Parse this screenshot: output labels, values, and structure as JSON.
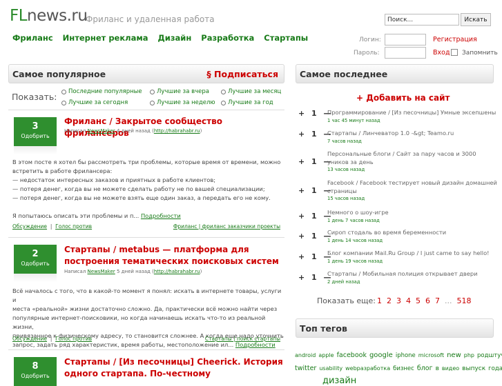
{
  "header": {
    "logo_prefix": "FL",
    "logo_suffix": "news.ru",
    "tagline": "Фриланс и удаленная работа",
    "search_placeholder": "Поиск...",
    "search_button": "Искать"
  },
  "nav": [
    "Фриланс",
    "Интернет реклама",
    "Дизайн",
    "Разработка",
    "Стартапы"
  ],
  "auth": {
    "login_label": "Логин:",
    "password_label": "Пароль:",
    "register": "Регистрация",
    "login_link": "Вход",
    "remember": "Запомнить"
  },
  "popular": {
    "title": "Самое популярное",
    "subscribe": "§ Подписаться",
    "show_label": "Показать:",
    "filters": [
      "Последние популярные",
      "Лучшие за вчера",
      "Лучшие за месяц",
      "Лучшие за сегодня",
      "Лучшие за неделю",
      "Лучшие за год"
    ]
  },
  "posts": [
    {
      "votes": "3",
      "vote_label": "Одобрить",
      "title": "Фриланс / Закрытое сообщество фрилансеров",
      "meta_prefix": "Написал",
      "author": "NewsMaker",
      "meta_time": "4 дней назад (",
      "source": "http://habrahabr.ru",
      "meta_end": ")",
      "body": [
        "В этом посте я хотел бы рассмотреть три проблемы, которые время от времени, можно",
        "встретить в работе фрилансера:",
        "— недостаток интересных заказов и приятных в работе клиентов;",
        "— потеря денег, когда вы не можете сделать работу не по вашей специализации;",
        "— потеря денег, когда вы не можете взять еще один заказ, а передать его не кому.",
        "",
        "Я попытаюсь описать эти проблемы и п..."
      ],
      "more": "Подробности",
      "discuss": "Обсуждение",
      "against": "Голос против",
      "tags": "Фриланс | фриланс заказчики проекты"
    },
    {
      "votes": "2",
      "vote_label": "Одобрить",
      "title": "Стартапы / metabus — платформа для построения тематических поисковых систем",
      "meta_prefix": "Написал",
      "author": "NewsMaker",
      "meta_time": "5 дней назад (",
      "source": "http://habrahabr.ru",
      "meta_end": ")",
      "body": [
        "Всё началось с того, что в какой-то момент я понял: искать в интернете товары, услуги и",
        "места «реальной» жизни достаточно сложно. Да, практически всё можно найти через",
        "популярные интернет-поисковики, но когда начинаешь искать что-то из реальной жизни,",
        "привязанное к физическому адресу, то становится сложнее. А когда еще надо уточнить",
        "запрос, задать ряд характеристик, время работы, местоположение ил..."
      ],
      "more": "Подробности",
      "discuss": "Обсуждение",
      "against": "Голос против",
      "tags": "Стартапы | поиск стартапы"
    },
    {
      "votes": "8",
      "vote_label": "Одобрить",
      "title": "Стартапы / [Из песочницы] Cheerick. История одного стартапа. По-честному"
    }
  ],
  "latest": {
    "title": "Самое последнее",
    "add": "+ Добавить на сайт",
    "items": [
      {
        "pm": "+ 1 —",
        "title": "Программирование / [Из песочницы] Умные эксепшены",
        "time": "1 час 45 минут назад"
      },
      {
        "pm": "+ 1 —",
        "title": "Стартапы / Линчеватор 1.0 -&gt; Teamo.ru",
        "time": "7 часов назад"
      },
      {
        "pm": "+ 1 —",
        "title": "Персональные блоги / Сайт за пару часов и 3000 уников за день",
        "time": "13 часов назад"
      },
      {
        "pm": "+ 1 —",
        "title": "Facebook / Facebook тестирует новый дизайн домашней страницы",
        "time": "15 часов назад"
      },
      {
        "pm": "+ 1 —",
        "title": "Немного о шоу-игре",
        "time": "1 день 7 часов назад"
      },
      {
        "pm": "+ 1 —",
        "title": "Сироп стодаль во время беременности",
        "time": "1 день 14 часов назад"
      },
      {
        "pm": "+ 1 —",
        "title": "Блог компании Mail.Ru Group / I just came to say hello!",
        "time": "1 день 19 часов назад"
      },
      {
        "pm": "+ 1 —",
        "title": "Стартапы / Мобильная полиция открывает двери",
        "time": "2 дней назад"
      }
    ],
    "more_label": "Показать еще:",
    "pages": [
      "1",
      "2",
      "3",
      "4",
      "5",
      "6",
      "7",
      "...",
      "518"
    ]
  },
  "top_tags": {
    "title": "Топ тегов",
    "tags": [
      "android",
      "apple",
      "facebook",
      "google",
      "iphone",
      "microsoft",
      "new",
      "php",
      "родштучки",
      "twitter",
      "usability",
      "webразработка",
      "бизнес",
      "блог",
      "в",
      "видео",
      "выпуск",
      "года",
      "дизайн"
    ]
  }
}
